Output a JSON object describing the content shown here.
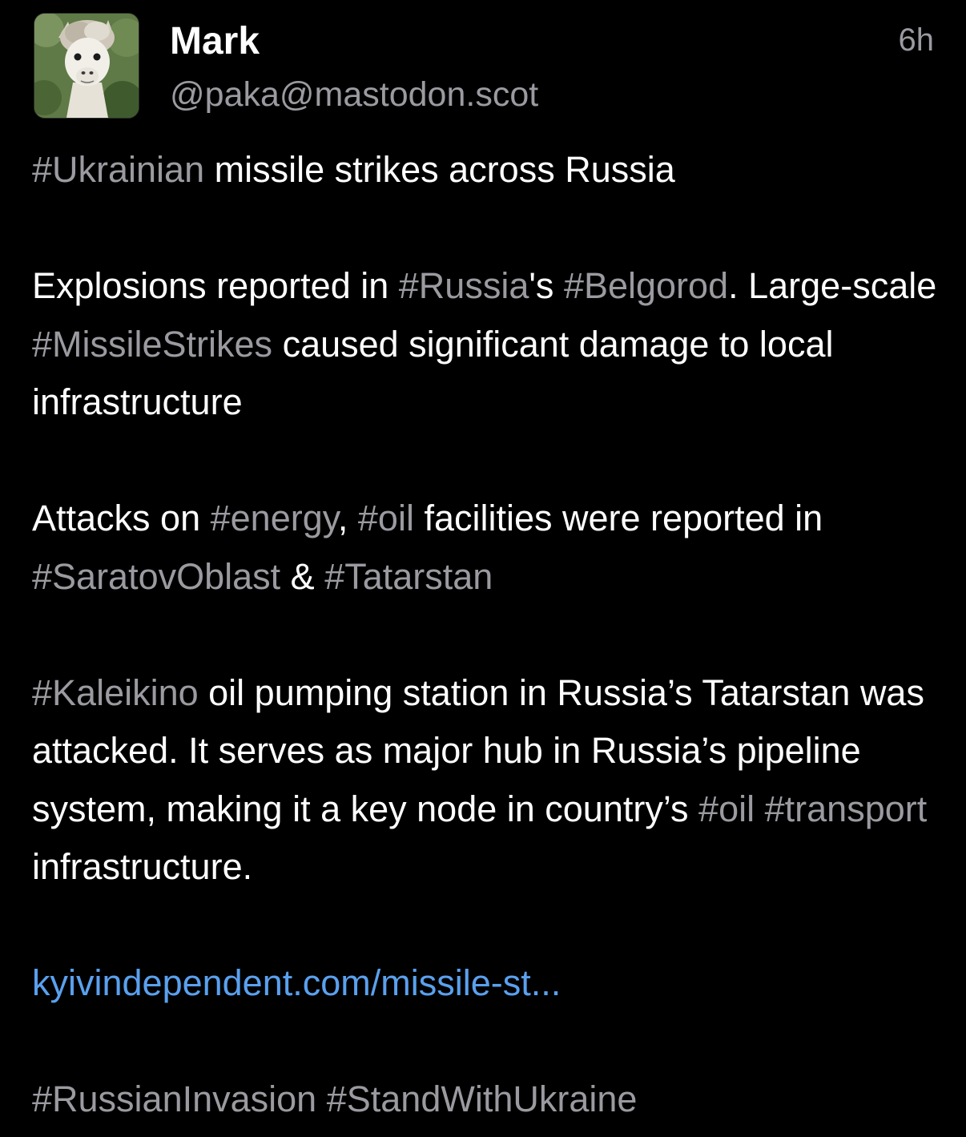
{
  "post": {
    "author_name": "Mark",
    "author_handle": "@paka@mastodon.scot",
    "time_ago": "6h",
    "avatar_icon": "alpaca-avatar",
    "para1": {
      "tag_ukrainian": "#Ukrainian",
      "text_a": " missile strikes across Russia"
    },
    "para2": {
      "text_a": "Explosions reported in ",
      "tag_russia": "#Russia",
      "text_b": "'s ",
      "tag_belgorod": "#Belgorod",
      "text_c": ". Large-scale ",
      "tag_missilestrikes": "#MissileStrikes",
      "text_d": " caused significant damage to local infrastructure"
    },
    "para3": {
      "text_a": "Attacks on ",
      "tag_energy": "#energy",
      "text_b": ", ",
      "tag_oil": "#oil",
      "text_c": " facilities were reported in ",
      "tag_saratov": "#SaratovOblast",
      "text_d": " & ",
      "tag_tatarstan": "#Tatarstan"
    },
    "para4": {
      "tag_kaleikino": "#Kaleikino",
      "text_a": " oil pumping station in Russia’s Tatarstan was attacked. It serves as major hub in Russia’s pipeline system, making it a key node in country’s ",
      "tag_oil": "#oil",
      "text_b": " ",
      "tag_transport": "#transport",
      "text_c": " infrastructure."
    },
    "link_text": "kyivindependent.com/missile-st...",
    "para6": {
      "tag_invasion": "#RussianInvasion",
      "text_a": " ",
      "tag_standwithukraine": "#StandWithUkraine"
    }
  },
  "colors": {
    "background": "#000000",
    "text": "#ffffff",
    "secondary": "#9a9aa0",
    "link": "#5aa0ee"
  }
}
